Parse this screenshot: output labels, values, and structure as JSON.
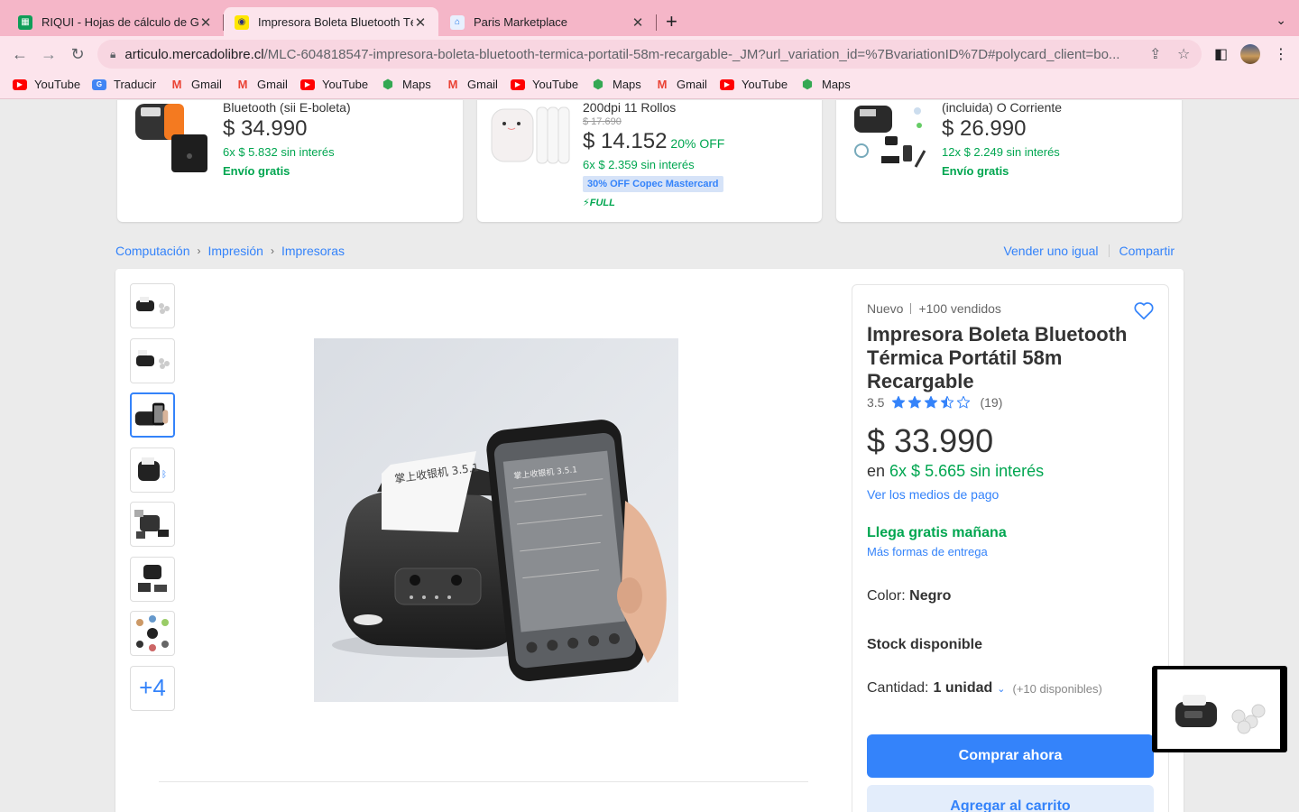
{
  "browser": {
    "tabs": [
      {
        "title": "RIQUI - Hojas de cálculo de Go",
        "icon": "sheets-icon"
      },
      {
        "title": "Impresora Boleta Bluetooth Tér",
        "icon": "mercadolibre-icon"
      },
      {
        "title": "Paris Marketplace",
        "icon": "paris-icon"
      }
    ],
    "url_host": "articulo.mercadolibre.cl",
    "url_path": "/MLC-604818547-impresora-boleta-bluetooth-termica-portatil-58m-recargable-_JM?url_variation_id=%7BvariationID%7D#polycard_client=bo...",
    "bookmarks": [
      {
        "label": "YouTube",
        "type": "yt"
      },
      {
        "label": "Traducir",
        "type": "tr"
      },
      {
        "label": "Gmail",
        "type": "gm"
      },
      {
        "label": "Gmail",
        "type": "gm"
      },
      {
        "label": "YouTube",
        "type": "yt"
      },
      {
        "label": "Maps",
        "type": "mp"
      },
      {
        "label": "Gmail",
        "type": "gm"
      },
      {
        "label": "YouTube",
        "type": "yt"
      },
      {
        "label": "Maps",
        "type": "mp"
      },
      {
        "label": "Gmail",
        "type": "gm"
      },
      {
        "label": "YouTube",
        "type": "yt"
      },
      {
        "label": "Maps",
        "type": "mp"
      }
    ]
  },
  "recommendations": [
    {
      "title": "Bluetooth (sii E-boleta)",
      "old_price": "",
      "price": "$ 34.990",
      "discount": "",
      "installments": "6x $ 5.832 sin interés",
      "shipping": "Envío gratis",
      "badge": "",
      "full": ""
    },
    {
      "title": "200dpi 11 Rollos",
      "old_price": "$ 17.690",
      "price": "$ 14.152",
      "discount": "20% OFF",
      "installments": "6x $ 2.359 sin interés",
      "shipping": "",
      "badge": "30% OFF Copec Mastercard",
      "full": "FULL"
    },
    {
      "title": "(incluida) O Corriente",
      "old_price": "",
      "price": "$ 26.990",
      "discount": "",
      "installments": "12x $ 2.249 sin interés",
      "shipping": "Envío gratis",
      "badge": "",
      "full": ""
    }
  ],
  "breadcrumb": [
    "Computación",
    "Impresión",
    "Impresoras"
  ],
  "top_actions": {
    "sell": "Vender uno igual",
    "share": "Compartir"
  },
  "gallery": {
    "more_label": "+4"
  },
  "product": {
    "condition": "Nuevo",
    "sold": "+100 vendidos",
    "title": "Impresora Boleta Bluetooth Térmica Portátil 58m Recargable",
    "rating": "3.5",
    "rating_value": 3.5,
    "reviews": "(19)",
    "price": "$ 33.990",
    "installments_prefix": "en",
    "installments": "6x $ 5.665 sin interés",
    "payment_link": "Ver los medios de pago",
    "shipping": "Llega gratis mañana",
    "shipping_link": "Más formas de entrega",
    "color_label": "Color:",
    "color_value": "Negro",
    "stock": "Stock disponible",
    "quantity_label": "Cantidad:",
    "quantity_value": "1 unidad",
    "quantity_available": "(+10 disponibles)",
    "buy_label": "Comprar ahora",
    "cart_label": "Agregar al carrito"
  },
  "colors": {
    "accent": "#3483fa",
    "green": "#00a650",
    "tabbar": "#f5b6c8"
  }
}
